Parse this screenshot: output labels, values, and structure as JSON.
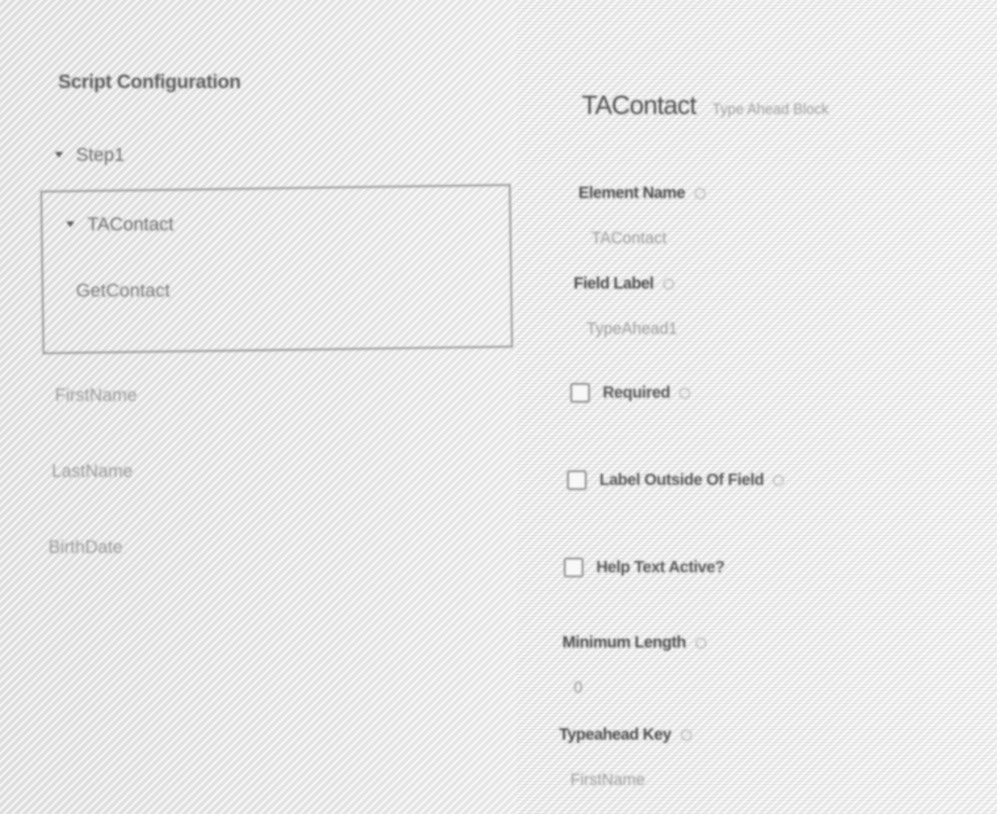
{
  "left_panel": {
    "title": "Script Configuration",
    "step": {
      "label": "Step1"
    },
    "selected_block": {
      "label": "TAContact",
      "child": "GetContact"
    },
    "fields": [
      {
        "label": "FirstName"
      },
      {
        "label": "LastName"
      },
      {
        "label": "BirthDate"
      }
    ]
  },
  "properties": {
    "element_title": "TAContact",
    "element_type": "Type Ahead Block",
    "element_name": {
      "label": "Element Name",
      "value": "TAContact"
    },
    "field_label": {
      "label": "Field Label",
      "value": "TypeAhead1"
    },
    "required": {
      "label": "Required",
      "checked": false
    },
    "label_outside": {
      "label": "Label Outside Of Field",
      "checked": false
    },
    "help_text": {
      "label": "Help Text Active?",
      "checked": false
    },
    "minimum_length": {
      "label": "Minimum Length",
      "value": "0"
    },
    "typeahead_key": {
      "label": "Typeahead Key",
      "value": "FirstName"
    }
  },
  "icons": {
    "caret": "caret-down-icon",
    "info": "info-circle-icon"
  }
}
